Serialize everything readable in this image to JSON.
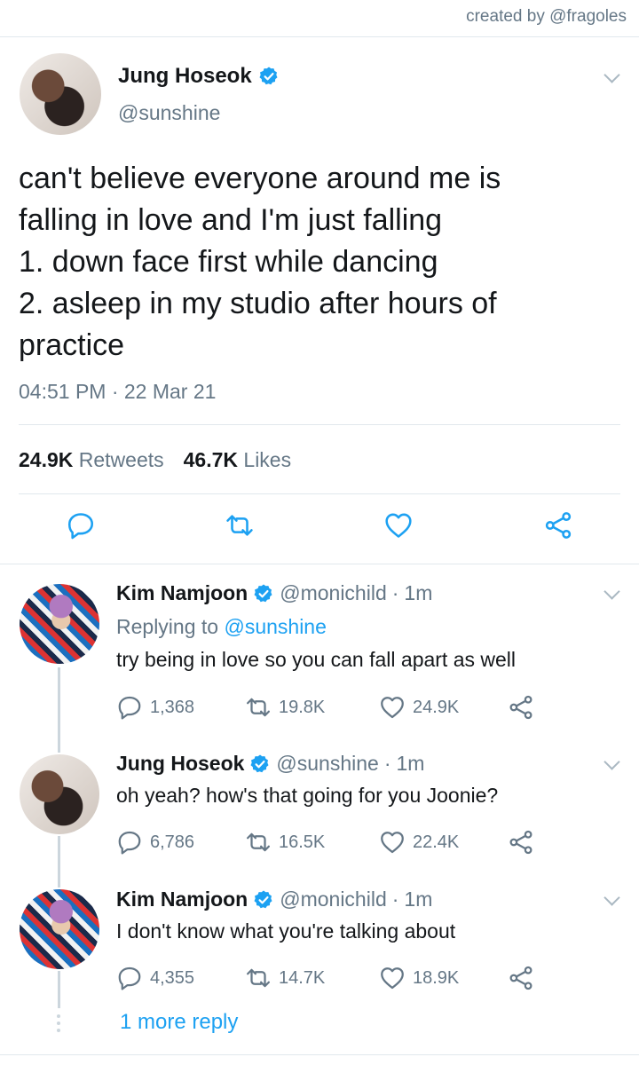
{
  "credit": "created by @fragoles",
  "main_tweet": {
    "name": "Jung Hoseok",
    "handle": "@sunshine",
    "text_lines": [
      "can't believe everyone around me is",
      "falling in love and I'm just falling",
      "1. down face first while dancing",
      "2. asleep in my studio after hours of",
      "practice"
    ],
    "timestamp": "04:51 PM · 22 Mar 21",
    "retweets_count": "24.9K",
    "retweets_label": "Retweets",
    "likes_count": "46.7K",
    "likes_label": "Likes"
  },
  "replies": [
    {
      "name": "Kim Namjoon",
      "handle": "@monichild",
      "dot": "·",
      "time": "1m",
      "replying_prefix": "Replying to",
      "replying_to": "@sunshine",
      "text": "try being in love so you can fall apart as well",
      "comments": "1,368",
      "retweets": "19.8K",
      "likes": "24.9K"
    },
    {
      "name": "Jung Hoseok",
      "handle": "@sunshine",
      "dot": "·",
      "time": "1m",
      "text": "oh yeah? how's that going for you Joonie?",
      "comments": "6,786",
      "retweets": "16.5K",
      "likes": "22.4K"
    },
    {
      "name": "Kim Namjoon",
      "handle": "@monichild",
      "dot": "·",
      "time": "1m",
      "text": "I don't know what you're talking about",
      "comments": "4,355",
      "retweets": "14.7K",
      "likes": "18.9K"
    }
  ],
  "more_replies": "1 more reply",
  "colors": {
    "accent": "#1da1f2",
    "muted": "#657786",
    "divider": "#e1e8ed"
  },
  "icons": [
    "verified-icon",
    "chevron-down-icon",
    "reply-icon",
    "retweet-icon",
    "like-icon",
    "share-icon"
  ]
}
